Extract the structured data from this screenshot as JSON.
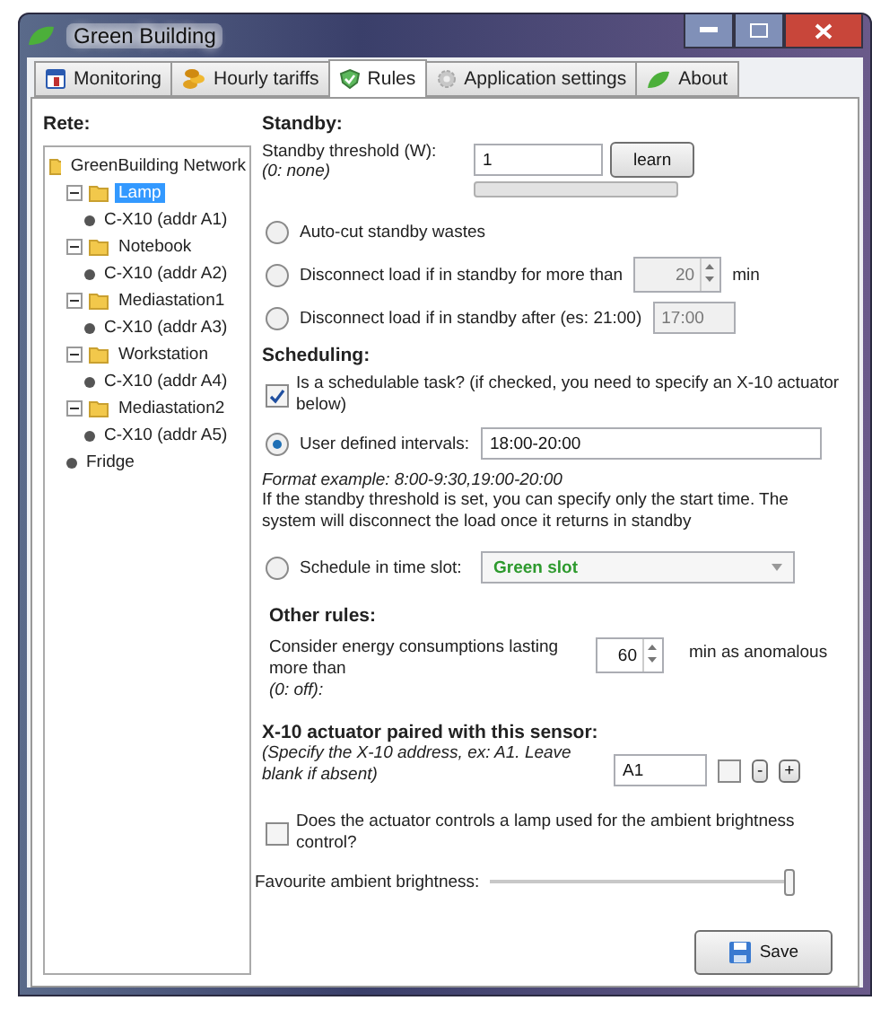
{
  "window": {
    "title": "Green Building"
  },
  "tabs": [
    {
      "label": "Monitoring",
      "selected": false,
      "kind": "calendar"
    },
    {
      "label": "Hourly tariffs",
      "selected": false,
      "kind": "coins"
    },
    {
      "label": "Rules",
      "selected": true,
      "kind": "shield"
    },
    {
      "label": "Application settings",
      "selected": false,
      "kind": "gear"
    },
    {
      "label": "About",
      "selected": false,
      "kind": "leaf"
    }
  ],
  "tree": {
    "title": "Rete:",
    "root": {
      "label": "GreenBuilding Network",
      "kind": "folder",
      "selected": false,
      "children": [
        {
          "label": "Lamp",
          "kind": "folder",
          "selected": true,
          "expanded": true,
          "children": [
            {
              "label": "C-X10 (addr A1)",
              "kind": "device",
              "selected": false
            }
          ]
        },
        {
          "label": "Notebook",
          "kind": "folder",
          "selected": false,
          "expanded": true,
          "children": [
            {
              "label": "C-X10 (addr A2)",
              "kind": "device",
              "selected": false
            }
          ]
        },
        {
          "label": "Mediastation1",
          "kind": "folder",
          "selected": false,
          "expanded": true,
          "children": [
            {
              "label": "C-X10 (addr A3)",
              "kind": "device",
              "selected": false
            }
          ]
        },
        {
          "label": "Workstation",
          "kind": "folder",
          "selected": false,
          "expanded": true,
          "children": [
            {
              "label": "C-X10 (addr A4)",
              "kind": "device",
              "selected": false
            }
          ]
        },
        {
          "label": "Mediastation2",
          "kind": "folder",
          "selected": false,
          "expanded": true,
          "children": [
            {
              "label": "C-X10 (addr A5)",
              "kind": "device",
              "selected": false
            }
          ]
        },
        {
          "label": "Fridge",
          "kind": "device",
          "selected": false
        }
      ]
    }
  },
  "standby": {
    "title": "Standby:",
    "threshold_label": "Standby threshold (W):",
    "threshold_hint": "(0: none)",
    "threshold_value": "1",
    "learn_button": "learn",
    "options": [
      {
        "label": "Auto-cut standby wastes",
        "selected": false,
        "kind": "plain"
      },
      {
        "label": "Disconnect load if in standby for more than",
        "selected": false,
        "kind": "spin",
        "value": "20",
        "unit": "min",
        "disabled": true
      },
      {
        "label": "Disconnect load if in standby after (es: 21:00)",
        "selected": false,
        "kind": "time",
        "value": "17:00",
        "disabled": true
      }
    ]
  },
  "scheduling": {
    "title": "Scheduling:",
    "schedulable": {
      "label": "Is a schedulable task? (if checked, you need to specify an X-10 actuator below)",
      "checked": true
    },
    "user_intervals": {
      "label": "User defined intervals:",
      "selected": true,
      "value": "18:00-20:00"
    },
    "format_example": "Format example: 8:00-9:30,19:00-20:00",
    "note": "If the standby threshold is set, you can specify only the start time. The system will disconnect the load once it returns in standby",
    "time_slot": {
      "label": "Schedule in time slot:",
      "selected": false,
      "value": "Green slot",
      "color": "#2e9a2e"
    }
  },
  "other_rules": {
    "title": "Other rules:",
    "label": "Consider energy consumptions lasting more than",
    "hint": "(0: off):",
    "value": "60",
    "suffix": "min as anomalous"
  },
  "actuator": {
    "title": "X-10 actuator paired with this sensor:",
    "hint": "(Specify the X-10 address, ex: A1. Leave blank if absent)",
    "value": "A1",
    "checked": false,
    "minus": "-",
    "plus": "+"
  },
  "ambient": {
    "label": "Does the actuator controls a lamp used for the ambient brightness control?",
    "checked": false
  },
  "brightness": {
    "label": "Favourite ambient brightness:",
    "level": 1
  },
  "save_button": "Save"
}
